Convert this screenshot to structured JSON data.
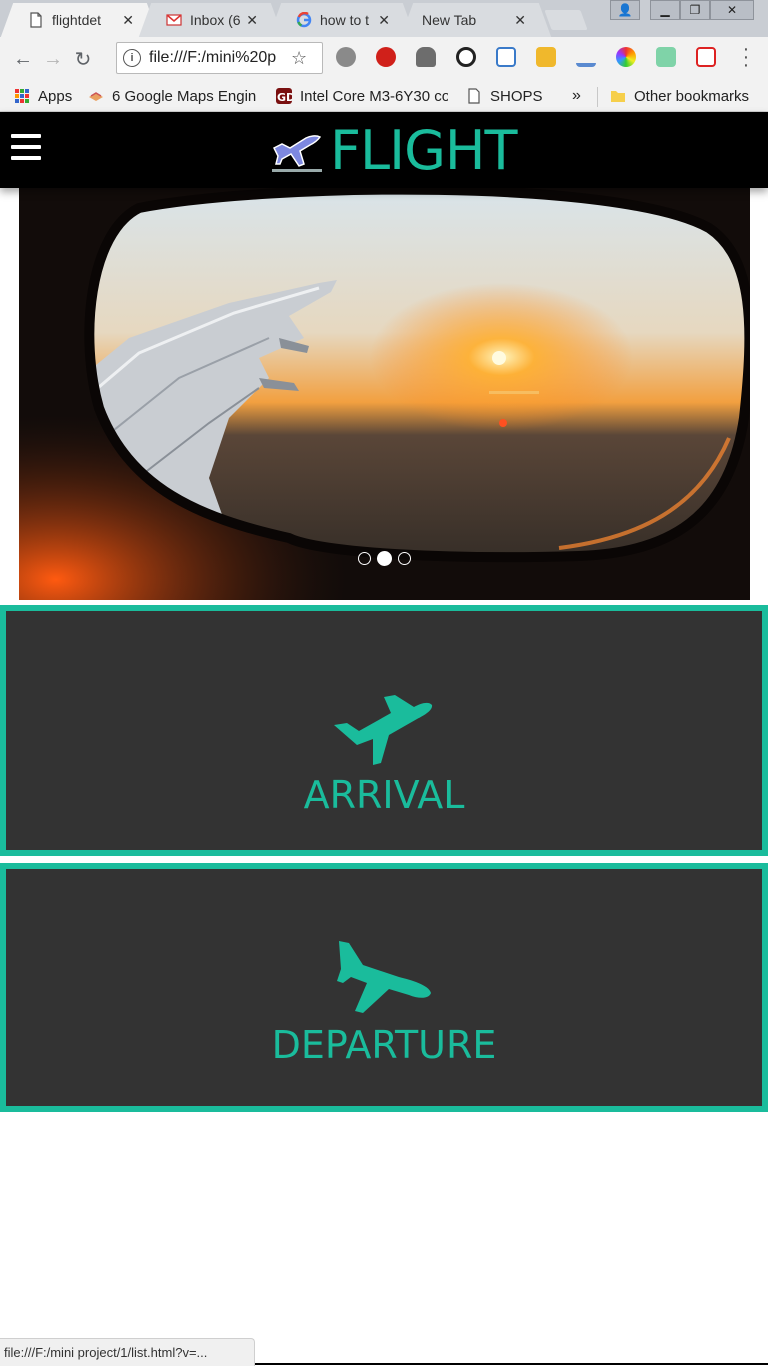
{
  "browser": {
    "tabs": [
      {
        "title": "flightdet",
        "icon": "document-icon",
        "active": true
      },
      {
        "title": "Inbox (6",
        "icon": "gmail-icon",
        "active": false
      },
      {
        "title": "how to t",
        "icon": "google-icon",
        "active": false
      },
      {
        "title": "New Tab",
        "icon": "",
        "active": false
      }
    ],
    "address": "file:///F:/mini%20p",
    "bookmarks": [
      {
        "label": "Apps",
        "icon": "apps-grid-icon"
      },
      {
        "label": "6 Google Maps Engin",
        "icon": "maps-engine-icon"
      },
      {
        "label": "Intel Core M3-6Y30 co",
        "icon": "gd-icon"
      },
      {
        "label": "SHOPS",
        "icon": "document-icon"
      },
      {
        "label": "»",
        "icon": ""
      },
      {
        "label": "Other bookmarks",
        "icon": "folder-icon"
      }
    ],
    "status_url": "file:///F:/mini project/1/list.html?v=..."
  },
  "header": {
    "brand": "FLIGHT",
    "logo_icon": "airplane-logo-icon",
    "menu_icon": "hamburger-menu-icon"
  },
  "carousel": {
    "image": "airplane window view of wing at sunset",
    "slide_count": 3,
    "active_index": 1
  },
  "cards": {
    "arrival": {
      "label": "ARRIVAL",
      "icon": "airplane-takeoff-icon"
    },
    "departure": {
      "label": "DEPARTURE",
      "icon": "airplane-landing-icon"
    }
  },
  "colors": {
    "accent": "#1abc9c",
    "header_bg": "#000000",
    "card_bg": "#333333"
  }
}
